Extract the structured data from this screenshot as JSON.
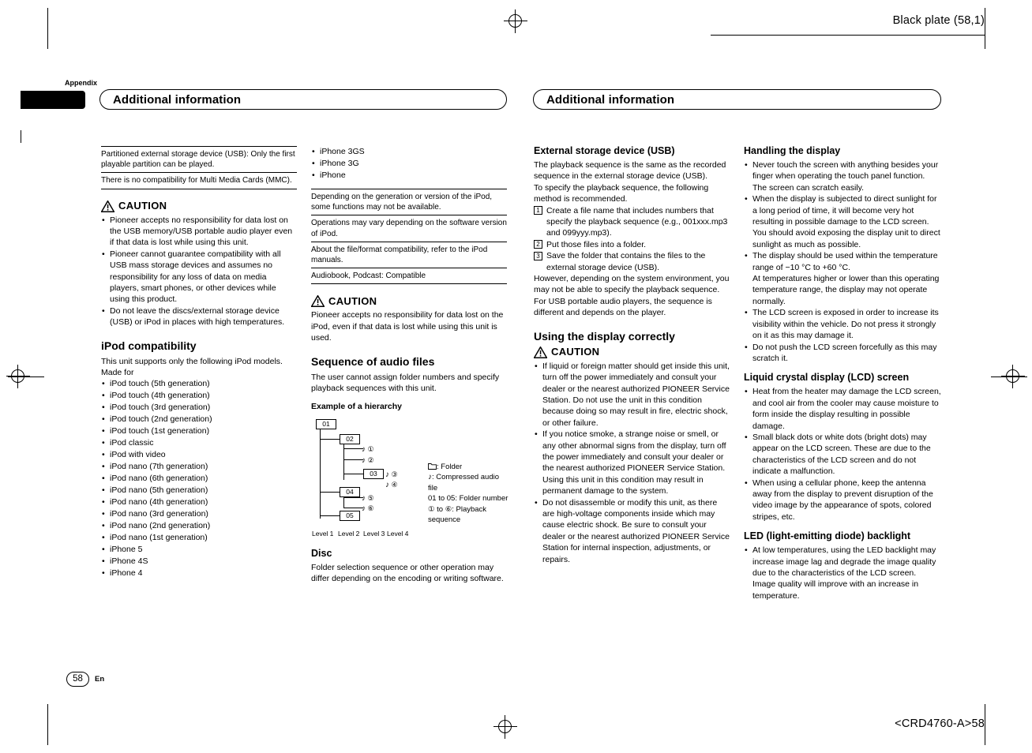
{
  "header": {
    "black_plate": "Black plate (58,1)",
    "footer_code": "<CRD4760-A>58",
    "appendix_tab": "Appendix"
  },
  "page_footer": {
    "number": "58",
    "language": "En"
  },
  "title_left": "Additional information",
  "title_right": "Additional information",
  "col1": {
    "notes": [
      "Partitioned external storage device (USB): Only the first playable partition can be played.",
      "There is no compatibility for Multi Media Cards (MMC)."
    ],
    "caution_label": "CAUTION",
    "caution_items": [
      "Pioneer accepts no responsibility for data lost on the USB memory/USB portable audio player even if that data is lost while using this unit.",
      "Pioneer cannot guarantee compatibility with all USB mass storage devices and assumes no responsibility for any loss of data on media players, smart phones, or other devices while using this product.",
      "Do not leave the discs/external storage device (USB) or iPod in places with high temperatures."
    ],
    "heading": "iPod compatibility",
    "intro": "This unit supports only the following iPod models.",
    "made_for": "Made for",
    "models": [
      "iPod touch (5th generation)",
      "iPod touch (4th generation)",
      "iPod touch (3rd generation)",
      "iPod touch (2nd generation)",
      "iPod touch (1st generation)",
      "iPod classic",
      "iPod with video",
      "iPod nano (7th generation)",
      "iPod nano (6th generation)",
      "iPod nano (5th generation)",
      "iPod nano (4th generation)",
      "iPod nano (3rd generation)",
      "iPod nano (2nd generation)",
      "iPod nano (1st generation)",
      "iPhone 5",
      "iPhone 4S",
      "iPhone 4"
    ]
  },
  "col2": {
    "models_cont": [
      "iPhone 3GS",
      "iPhone 3G",
      "iPhone"
    ],
    "notes": [
      "Depending on the generation or version of the iPod, some functions may not be available.",
      "Operations may vary depending on the software version of iPod.",
      "About the file/format compatibility, refer to the iPod manuals.",
      "Audiobook, Podcast: Compatible"
    ],
    "caution_label": "CAUTION",
    "caution_text": "Pioneer accepts no responsibility for data lost on the iPod, even if that data is lost while using this unit is used.",
    "heading": "Sequence of audio files",
    "body": "The user cannot assign folder numbers and specify playback sequences with this unit.",
    "example_label": "Example of a hierarchy",
    "diagram": {
      "folders": [
        "01",
        "02",
        "03",
        "04",
        "05"
      ],
      "levels": [
        "Level 1",
        "Level 2",
        "Level 3",
        "Level 4"
      ],
      "file_marks": [
        "①",
        "②",
        "③",
        "④",
        "⑤",
        "⑥"
      ],
      "legend": [
        ": Folder",
        ": Compressed audio file",
        "01 to 05: Folder number",
        "① to ⑥: Playback sequence"
      ]
    },
    "disc_heading": "Disc",
    "disc_body": "Folder selection sequence or other operation may differ depending on the encoding or writing software."
  },
  "col3": {
    "heading": "External storage device (USB)",
    "p1": "The playback sequence is the same as the recorded sequence in the external storage device (USB).",
    "p2": "To specify the playback sequence, the following method is recommended.",
    "steps": [
      "Create a file name that includes numbers that specify the playback sequence (e.g., 001xxx.mp3 and 099yyy.mp3).",
      "Put those files into a folder.",
      "Save the folder that contains the files to the external storage device (USB)."
    ],
    "p3": "However, depending on the system environment, you may not be able to specify the playback sequence.",
    "p4": "For USB portable audio players, the sequence is different and depends on the player.",
    "heading2": "Using the display correctly",
    "caution_label": "CAUTION",
    "caution_items": [
      "If liquid or foreign matter should get inside this unit, turn off the power immediately and consult your dealer or the nearest authorized PIONEER Service Station. Do not use the unit in this condition because doing so may result in fire, electric shock, or other failure.",
      "If you notice smoke, a strange noise or smell, or any other abnormal signs from the display, turn off the power immediately and consult your dealer or the nearest authorized PIONEER Service Station. Using this unit in this condition may result in permanent damage to the system.",
      "Do not disassemble or modify this unit, as there are high-voltage components inside which may cause electric shock. Be sure to consult your dealer or the nearest authorized PIONEER Service Station for internal inspection, adjustments, or repairs."
    ]
  },
  "col4": {
    "heading": "Handling the display",
    "items": [
      "Never touch the screen with anything besides your finger when operating the touch panel function. The screen can scratch easily.",
      "When the display is subjected to direct sunlight for a long period of time, it will become very hot resulting in possible damage to the LCD screen. You should avoid exposing the display unit to direct sunlight as much as possible.",
      "The display should be used within the temperature range of −10 °C to +60 °C.",
      "At temperatures higher or lower than this operating temperature range, the display may not operate normally.",
      "The LCD screen is exposed in order to increase its visibility within the vehicle. Do not press it strongly on it as this may damage it.",
      "Do not push the LCD screen forcefully as this may scratch it."
    ],
    "heading2": "Liquid crystal display (LCD) screen",
    "items2": [
      "Heat from the heater may damage the LCD screen, and cool air from the cooler may cause moisture to form inside the display resulting in possible damage.",
      "Small black dots or white dots (bright dots) may appear on the LCD screen. These are due to the characteristics of the LCD screen and do not indicate a malfunction.",
      "When using a cellular phone, keep the antenna away from the display to prevent disruption of the video image by the appearance of spots, colored stripes, etc."
    ],
    "heading3": "LED (light-emitting diode) backlight",
    "items3": [
      "At low temperatures, using the LED backlight may increase image lag and degrade the image quality due to the characteristics of the LCD screen. Image quality will improve with an increase in temperature."
    ]
  }
}
